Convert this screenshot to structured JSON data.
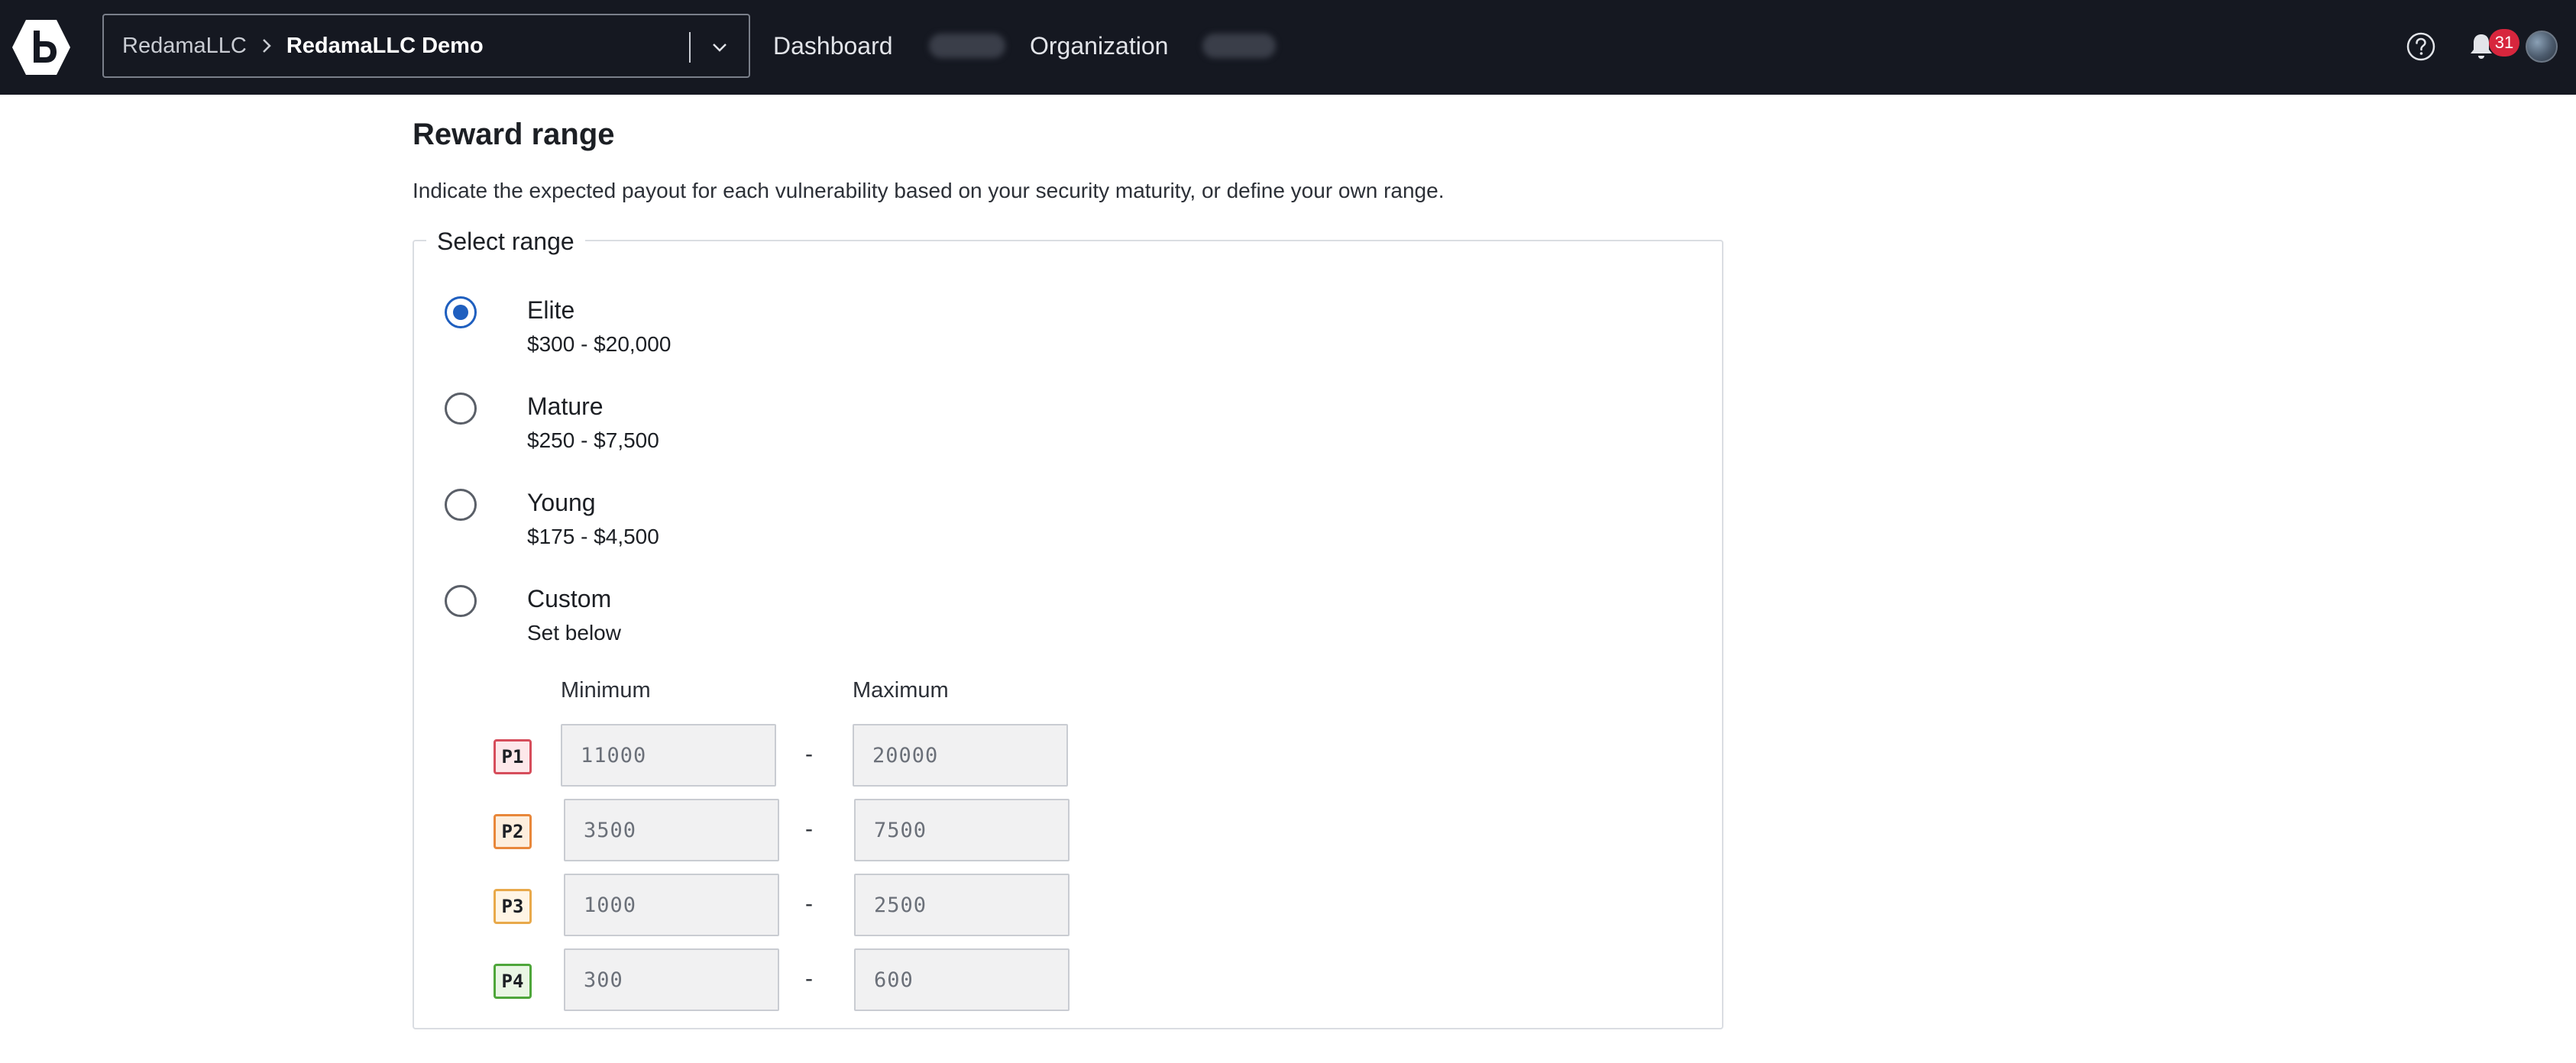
{
  "header": {
    "breadcrumb_parent": "RedamaLLC",
    "breadcrumb_current": "RedamaLLC Demo",
    "nav": {
      "dashboard": "Dashboard",
      "organization": "Organization"
    },
    "notification_count": "31",
    "icons": {
      "logo": "bugcrowd-logo-icon",
      "chevron": "chevron-down-icon",
      "separator": "chevron-right-icon",
      "help": "help-circle-icon",
      "bell": "bell-icon"
    }
  },
  "section": {
    "title": "Reward range",
    "description": "Indicate the expected payout for each vulnerability based on your security maturity, or define your own range."
  },
  "range_selector": {
    "legend": "Select range",
    "selected": "Elite",
    "options": [
      {
        "label": "Elite",
        "sublabel": "$300 - $20,000",
        "checked": true
      },
      {
        "label": "Mature",
        "sublabel": "$250 - $7,500",
        "checked": false
      },
      {
        "label": "Young",
        "sublabel": "$175 - $4,500",
        "checked": false
      },
      {
        "label": "Custom",
        "sublabel": "Set below",
        "checked": false
      }
    ]
  },
  "custom_range": {
    "min_header": "Minimum",
    "max_header": "Maximum",
    "separator": "-",
    "rows": [
      {
        "priority": "P1",
        "min_placeholder": "11000",
        "max_placeholder": "20000",
        "color": "#d64d5b"
      },
      {
        "priority": "P2",
        "min_placeholder": "3500",
        "max_placeholder": "7500",
        "color": "#e8873a"
      },
      {
        "priority": "P3",
        "min_placeholder": "1000",
        "max_placeholder": "2500",
        "color": "#e8a94a"
      },
      {
        "priority": "P4",
        "min_placeholder": "300",
        "max_placeholder": "600",
        "color": "#4ea63a"
      }
    ]
  },
  "colors": {
    "topbar_bg": "#151821",
    "accent": "#1f5fbf",
    "badge_bg": "#d7263d"
  }
}
